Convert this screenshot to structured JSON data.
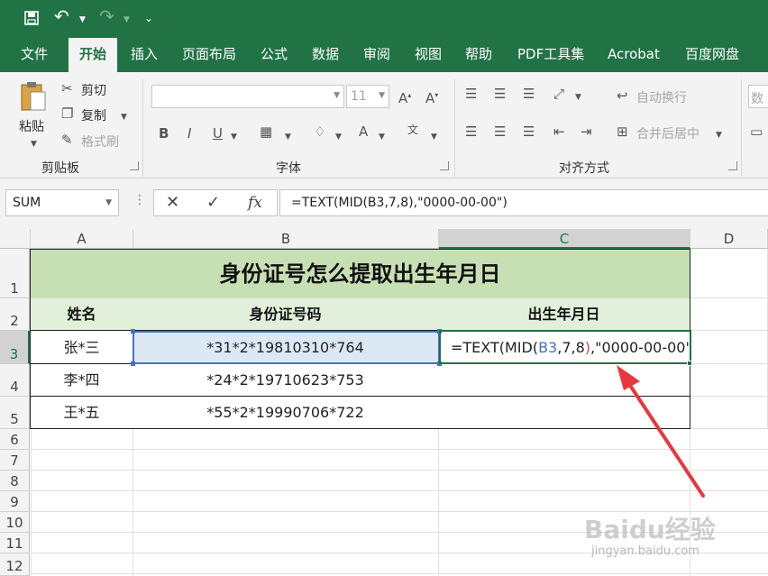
{
  "qat": {
    "save_icon": "save-icon",
    "undo_icon": "undo-icon",
    "redo_icon": "redo-icon",
    "customize_icon": "customize-icon"
  },
  "tabs": [
    "文件",
    "开始",
    "插入",
    "页面布局",
    "公式",
    "数据",
    "审阅",
    "视图",
    "帮助",
    "PDF工具集",
    "Acrobat",
    "百度网盘"
  ],
  "active_tab": "开始",
  "ribbon": {
    "clipboard": {
      "paste": "粘贴",
      "cut": "剪切",
      "copy": "复制",
      "format_painter": "格式刷",
      "label": "剪贴板"
    },
    "font": {
      "size": "11",
      "label": "字体",
      "bold": "B",
      "italic": "I",
      "underline": "U",
      "font_color": "A"
    },
    "alignment": {
      "wrap": "自动换行",
      "merge": "合并后居中",
      "label": "对齐方式"
    },
    "number": {
      "partial": "数"
    }
  },
  "formula_bar": {
    "name_box": "SUM",
    "fx": "fx",
    "formula": "=TEXT(MID(B3,7,8),\"0000-00-00\")"
  },
  "columns": [
    "A",
    "B",
    "C",
    "D"
  ],
  "rows": [
    "1",
    "2",
    "3",
    "4",
    "5",
    "6",
    "7",
    "8",
    "9",
    "10",
    "11",
    "12"
  ],
  "table": {
    "title": "身份证号怎么提取出生年月日",
    "headers": [
      "姓名",
      "身份证号码",
      "出生年月日"
    ],
    "data": [
      {
        "name": "张*三",
        "id": "*31*2*19810310*764"
      },
      {
        "name": "李*四",
        "id": "*24*2*19710623*753"
      },
      {
        "name": "王*五",
        "id": "*55*2*19990706*722"
      }
    ],
    "editing": {
      "pre": "=TEXT(MID(",
      "ref": "B3",
      "sep": ",7,8",
      "close": ")",
      "post": ",\"0000-00-00\")"
    }
  },
  "watermark": {
    "brand": "Baidu经验",
    "url": "jingyan.baidu.com"
  },
  "colors": {
    "excel_green": "#217346",
    "title_fill": "#c6e0b4",
    "header_fill": "#e2efda",
    "arrow_red": "#e8383d",
    "ref_blue": "#4472c4"
  }
}
